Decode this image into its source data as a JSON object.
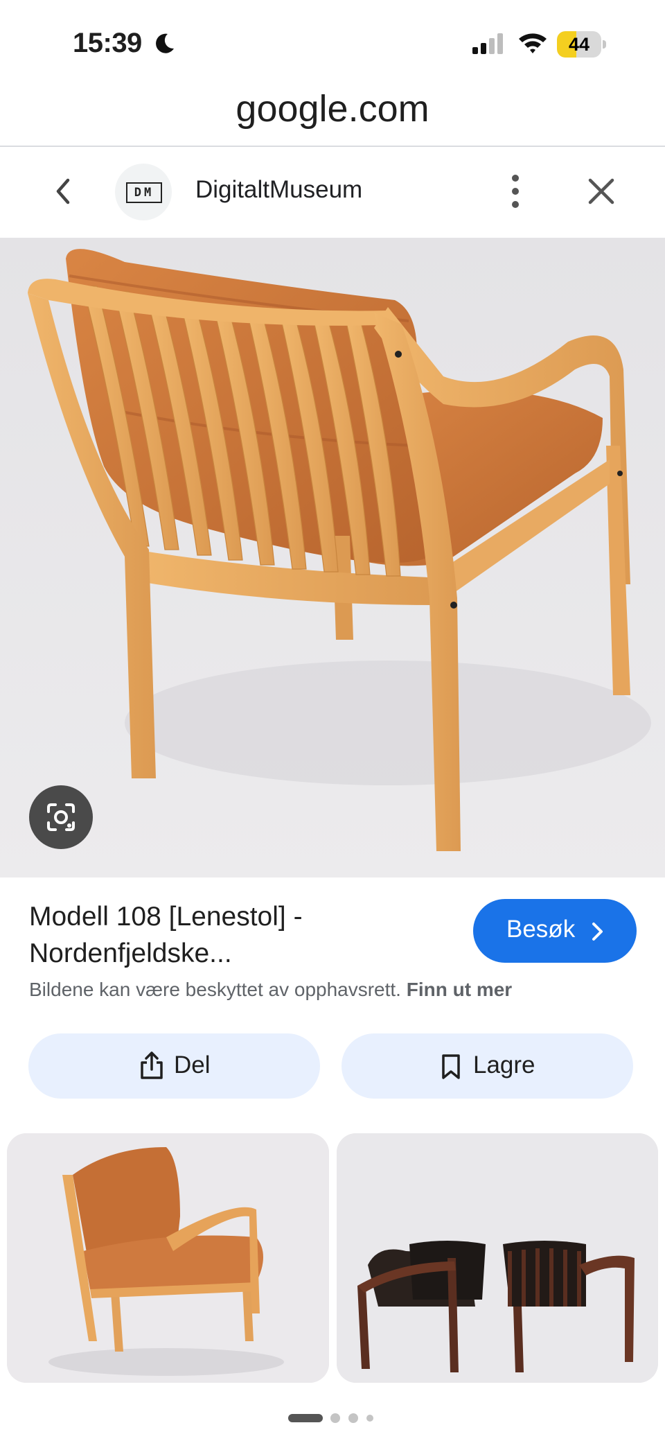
{
  "status_bar": {
    "time": "15:39",
    "battery_level": "44",
    "battery_fraction": 0.44,
    "icons": [
      "moon-icon",
      "signal-icon",
      "wifi-icon",
      "battery-icon"
    ]
  },
  "browser": {
    "url": "google.com"
  },
  "header": {
    "site_name": "DigitaltMuseum",
    "logo_text": "DM"
  },
  "result": {
    "title": "Modell 108 [Lenestol] - Nordenfjeldske...",
    "visit_label": "Besøk",
    "copyright_text": "Bildene kan være beskyttet av opphavsrett.",
    "copyright_link": "Finn ut mer"
  },
  "actions": {
    "share_label": "Del",
    "save_label": "Lagre"
  },
  "page_indicator": {
    "pages": 4,
    "active": 0
  },
  "colors": {
    "accent": "#1a73e8",
    "pill_bg": "#e8f0fe",
    "leather": "#c9733a",
    "wood": "#e3a35c",
    "battery": "#f4cf20"
  }
}
